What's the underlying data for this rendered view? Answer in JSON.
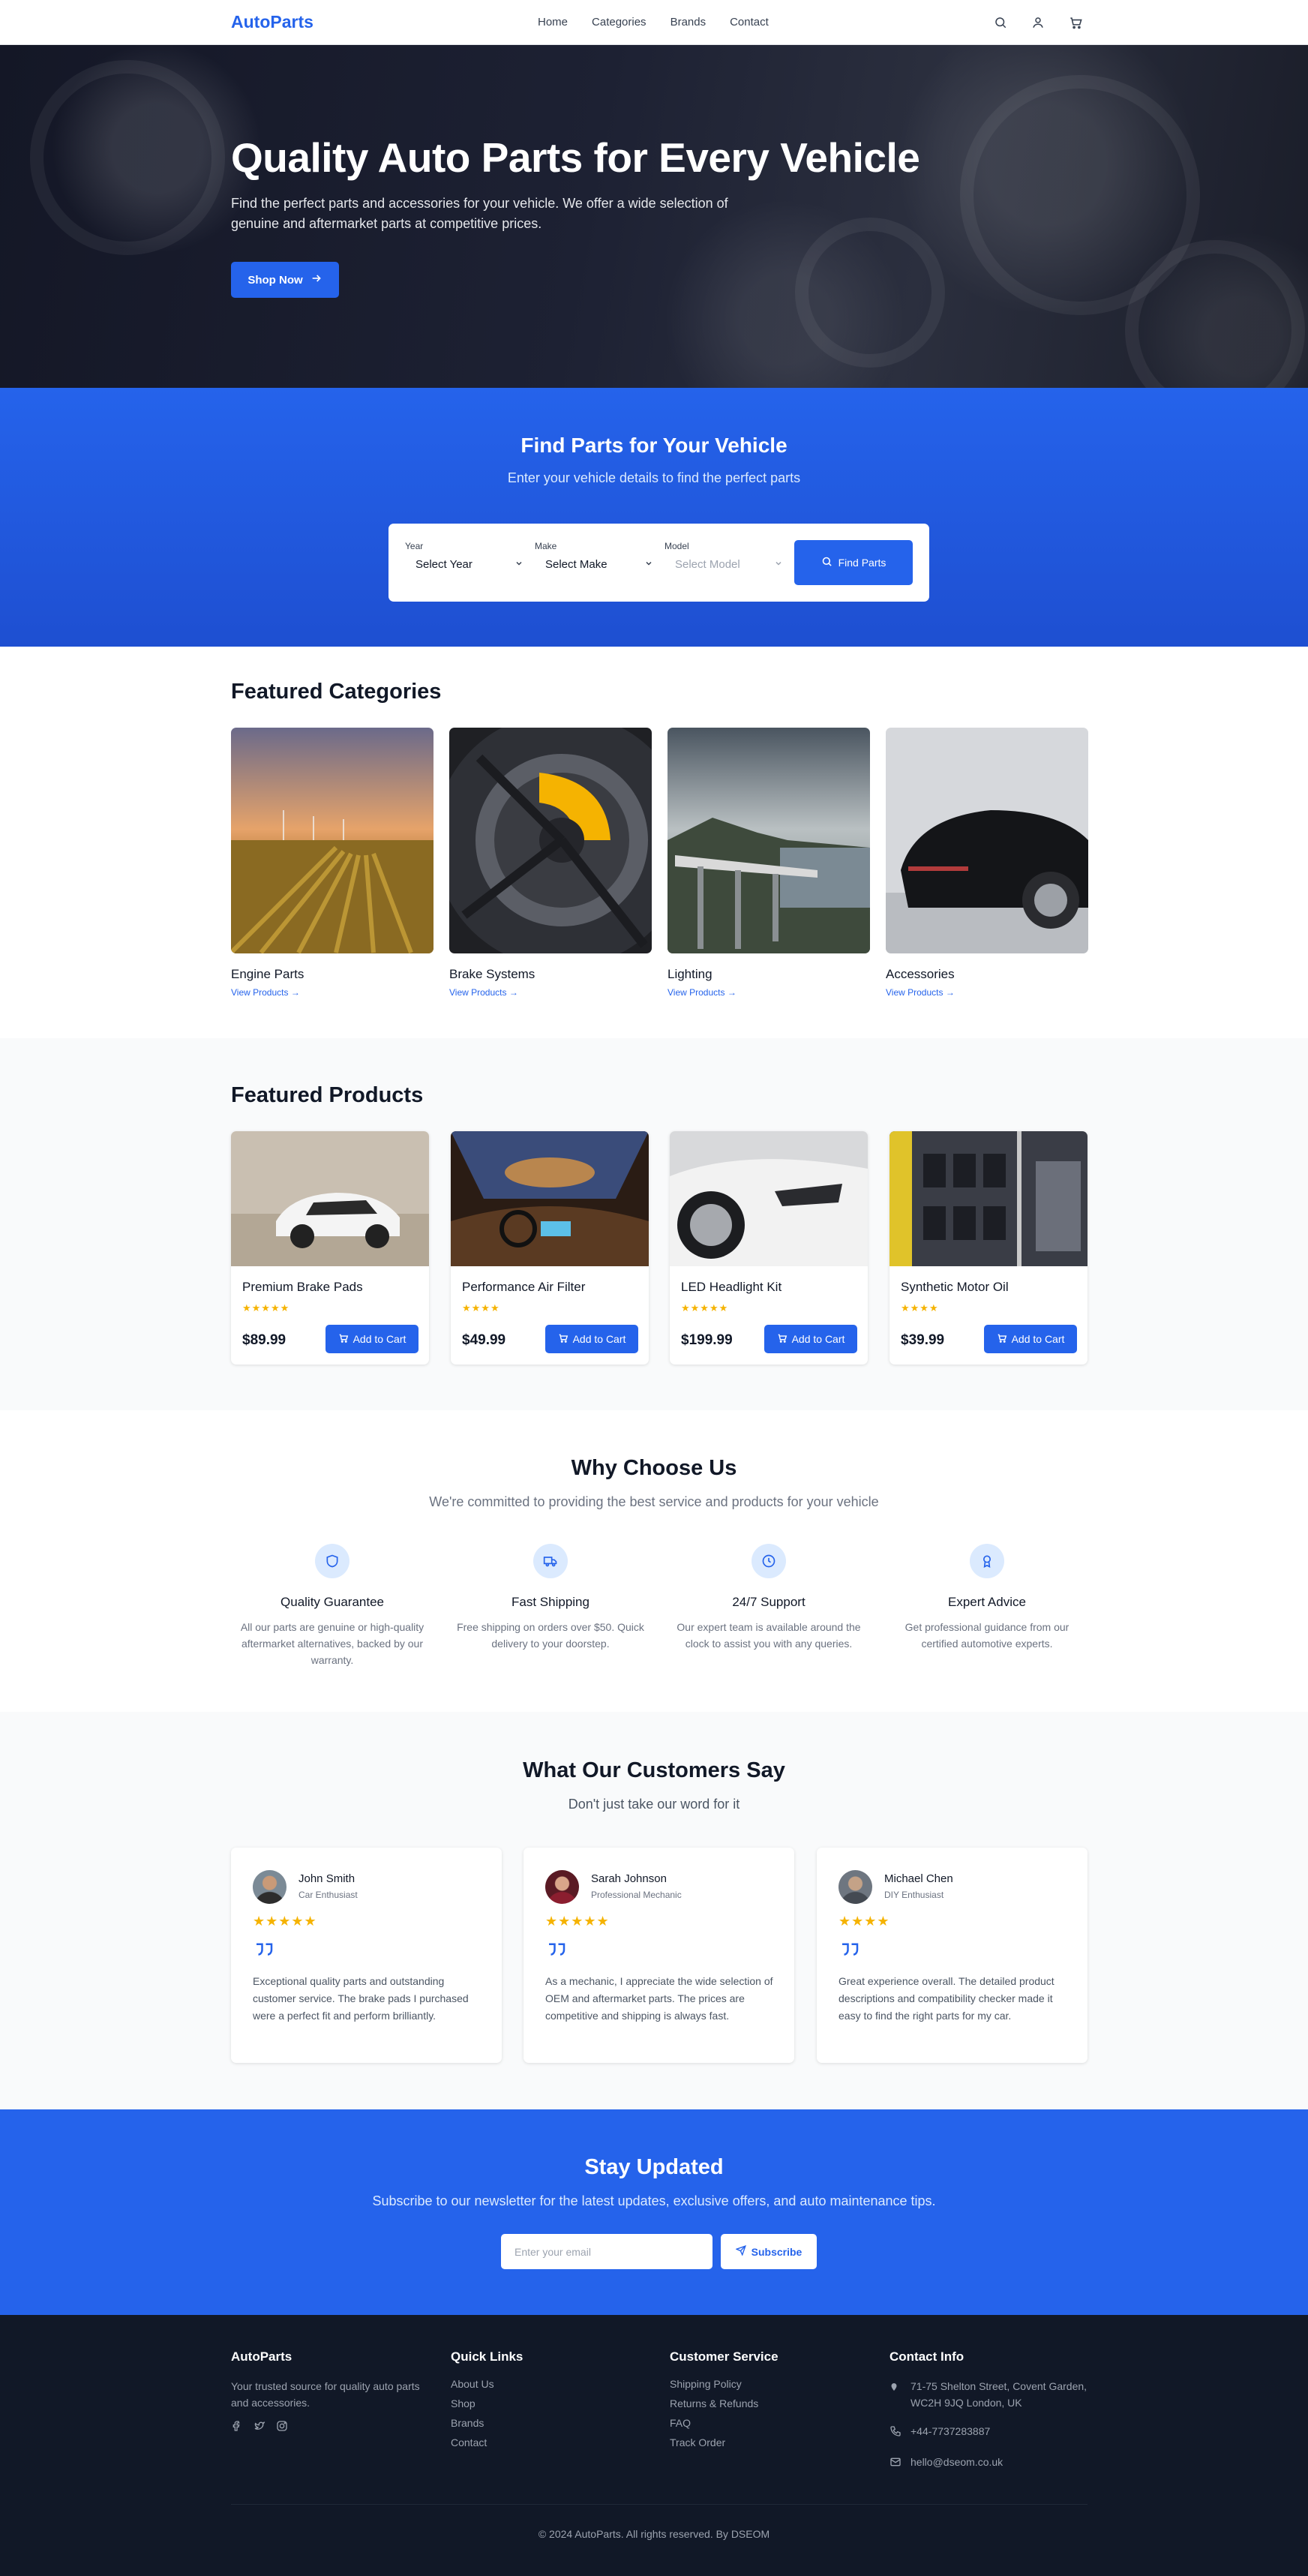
{
  "nav": {
    "brand": "AutoParts",
    "links": [
      "Home",
      "Categories",
      "Brands",
      "Contact"
    ],
    "icons": [
      "search-icon",
      "user-icon",
      "cart-icon"
    ]
  },
  "hero": {
    "title": "Quality Auto Parts for Every Vehicle",
    "subtitle": "Find the perfect parts and accessories for your vehicle. We offer a wide selection of genuine and aftermarket parts at competitive prices.",
    "cta": "Shop Now"
  },
  "finder": {
    "title": "Find Parts for Your Vehicle",
    "subtitle": "Enter your vehicle details to find the perfect parts",
    "year_label": "Year",
    "year_value": "Select Year",
    "make_label": "Make",
    "make_value": "Select Make",
    "model_label": "Model",
    "model_value": "Select Model",
    "button": "Find Parts"
  },
  "categories": {
    "title": "Featured Categories",
    "items": [
      {
        "name": "Engine Parts",
        "link": "View Products →"
      },
      {
        "name": "Brake Systems",
        "link": "View Products →"
      },
      {
        "name": "Lighting",
        "link": "View Products →"
      },
      {
        "name": "Accessories",
        "link": "View Products →"
      }
    ]
  },
  "products": {
    "title": "Featured Products",
    "cart_label": "Add to Cart",
    "items": [
      {
        "name": "Premium Brake Pads",
        "price": "$89.99",
        "stars": "★★★★★",
        "rating": 5
      },
      {
        "name": "Performance Air Filter",
        "price": "$49.99",
        "stars": "★★★★",
        "rating": 4
      },
      {
        "name": "LED Headlight Kit",
        "price": "$199.99",
        "stars": "★★★★★",
        "rating": 5
      },
      {
        "name": "Synthetic Motor Oil",
        "price": "$39.99",
        "stars": "★★★★",
        "rating": 4
      }
    ]
  },
  "why": {
    "title": "Why Choose Us",
    "subtitle": "We're committed to providing the best service and products for your vehicle",
    "items": [
      {
        "icon": "shield-icon",
        "title": "Quality Guarantee",
        "desc": "All our parts are genuine or high-quality aftermarket alternatives, backed by our warranty."
      },
      {
        "icon": "truck-icon",
        "title": "Fast Shipping",
        "desc": "Free shipping on orders over $50. Quick delivery to your doorstep."
      },
      {
        "icon": "clock-icon",
        "title": "24/7 Support",
        "desc": "Our expert team is available around the clock to assist you with any queries."
      },
      {
        "icon": "award-icon",
        "title": "Expert Advice",
        "desc": "Get professional guidance from our certified automotive experts."
      }
    ]
  },
  "testimonials": {
    "title": "What Our Customers Say",
    "subtitle": "Don't just take our word for it",
    "items": [
      {
        "name": "John Smith",
        "role": "Car Enthusiast",
        "stars": "★★★★★",
        "text": "Exceptional quality parts and outstanding customer service. The brake pads I purchased were a perfect fit and perform brilliantly."
      },
      {
        "name": "Sarah Johnson",
        "role": "Professional Mechanic",
        "stars": "★★★★★",
        "text": "As a mechanic, I appreciate the wide selection of OEM and aftermarket parts. The prices are competitive and shipping is always fast."
      },
      {
        "name": "Michael Chen",
        "role": "DIY Enthusiast",
        "stars": "★★★★",
        "text": "Great experience overall. The detailed product descriptions and compatibility checker made it easy to find the right parts for my car."
      }
    ]
  },
  "newsletter": {
    "title": "Stay Updated",
    "subtitle": "Subscribe to our newsletter for the latest updates, exclusive offers, and auto maintenance tips.",
    "placeholder": "Enter your email",
    "button": "Subscribe"
  },
  "footer": {
    "brand": "AutoParts",
    "tagline": "Your trusted source for quality auto parts and accessories.",
    "quick_title": "Quick Links",
    "quick_links": [
      "About Us",
      "Shop",
      "Brands",
      "Contact"
    ],
    "service_title": "Customer Service",
    "service_links": [
      "Shipping Policy",
      "Returns & Refunds",
      "FAQ",
      "Track Order"
    ],
    "contact_title": "Contact Info",
    "address": "71-75 Shelton Street, Covent Garden, WC2H 9JQ London, UK",
    "phone": "+44-7737283887",
    "email": "hello@dseom.co.uk",
    "copyright": "© 2024 AutoParts. All rights reserved. By DSEOM"
  },
  "colors": {
    "accent": "#2563eb",
    "star": "#f5b301",
    "footer_bg": "#111827"
  }
}
